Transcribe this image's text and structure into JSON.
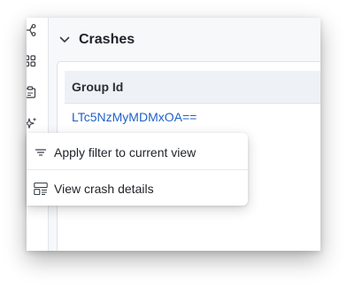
{
  "section": {
    "title": "Crashes"
  },
  "table": {
    "columns": [
      "Group Id"
    ],
    "rows": [
      {
        "group_id": "LTc5NzMyMDMxOA=="
      }
    ]
  },
  "context_menu": {
    "items": [
      {
        "label": "Apply filter to current view",
        "icon": "filter-icon"
      },
      {
        "label": "View crash details",
        "icon": "details-layout-icon"
      }
    ]
  },
  "sidebar": {
    "icons": [
      "branch-icon",
      "grid-icon",
      "clipboard-icon",
      "sparkle-icon"
    ]
  },
  "colors": {
    "link": "#1f62c7",
    "header_bg": "#eef1f5",
    "main_bg": "#f6f8fa"
  }
}
